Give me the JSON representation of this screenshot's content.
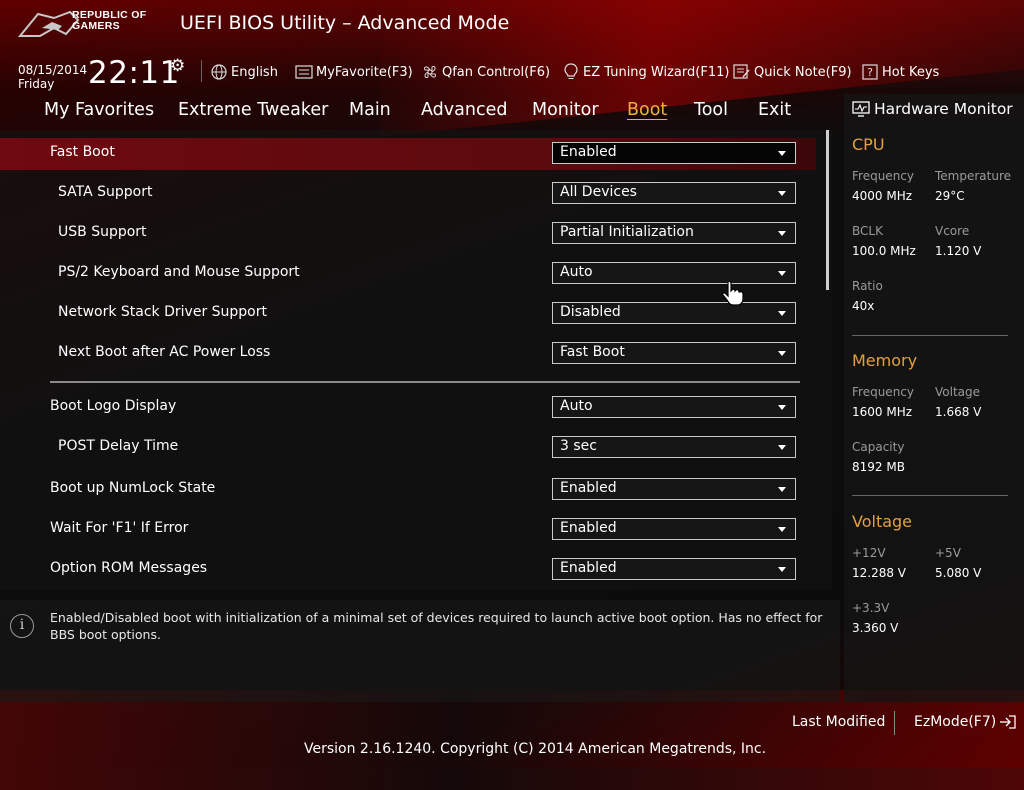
{
  "header": {
    "logo_line1": "REPUBLIC OF",
    "logo_line2": "GAMERS",
    "title": "UEFI BIOS Utility – Advanced Mode",
    "date": "08/15/2014",
    "day": "Friday",
    "time": "22:11"
  },
  "toolbar": {
    "language": "English",
    "myfavorite": "MyFavorite(F3)",
    "qfan": "Qfan Control(F6)",
    "ez_tuning": "EZ Tuning Wizard(F11)",
    "quick_note": "Quick Note(F9)",
    "hot_keys": "Hot Keys"
  },
  "nav": {
    "tabs": [
      "My Favorites",
      "Extreme Tweaker",
      "Main",
      "Advanced",
      "Monitor",
      "Boot",
      "Tool",
      "Exit"
    ],
    "active": "Boot"
  },
  "settings": [
    {
      "label": "Fast Boot",
      "value": "Enabled"
    },
    {
      "label": "SATA Support",
      "value": "All Devices"
    },
    {
      "label": "USB Support",
      "value": "Partial Initialization"
    },
    {
      "label": "PS/2 Keyboard and Mouse Support",
      "value": "Auto"
    },
    {
      "label": "Network Stack Driver Support",
      "value": "Disabled"
    },
    {
      "label": "Next Boot after AC Power Loss",
      "value": "Fast Boot"
    },
    {
      "label": "Boot Logo Display",
      "value": "Auto"
    },
    {
      "label": "POST Delay Time",
      "value": "3 sec"
    },
    {
      "label": "Boot up NumLock State",
      "value": "Enabled"
    },
    {
      "label": "Wait For 'F1' If Error",
      "value": "Enabled"
    },
    {
      "label": "Option ROM Messages",
      "value": "Enabled"
    }
  ],
  "help": {
    "text": "Enabled/Disabled boot with initialization of a minimal set of devices required to launch active boot option. Has no effect for BBS boot options."
  },
  "hw_monitor": {
    "title": "Hardware Monitor",
    "cpu": {
      "heading": "CPU",
      "frequency_label": "Frequency",
      "frequency": "4000 MHz",
      "temperature_label": "Temperature",
      "temperature": "29°C",
      "bclk_label": "BCLK",
      "bclk": "100.0 MHz",
      "vcore_label": "Vcore",
      "vcore": "1.120 V",
      "ratio_label": "Ratio",
      "ratio": "40x"
    },
    "memory": {
      "heading": "Memory",
      "frequency_label": "Frequency",
      "frequency": "1600 MHz",
      "voltage_label": "Voltage",
      "voltage": "1.668 V",
      "capacity_label": "Capacity",
      "capacity": "8192 MB"
    },
    "voltage": {
      "heading": "Voltage",
      "v12_label": "+12V",
      "v12": "12.288 V",
      "v5_label": "+5V",
      "v5": "5.080 V",
      "v33_label": "+3.3V",
      "v33": "3.360 V"
    }
  },
  "footer": {
    "last_modified": "Last Modified",
    "ezmode": "EzMode(F7)",
    "version": "Version 2.16.1240. Copyright (C) 2014 American Megatrends, Inc."
  },
  "colors": {
    "accent": "#f0b040",
    "highlight_row": "#6e0a10",
    "section_heading": "#e4a040"
  }
}
